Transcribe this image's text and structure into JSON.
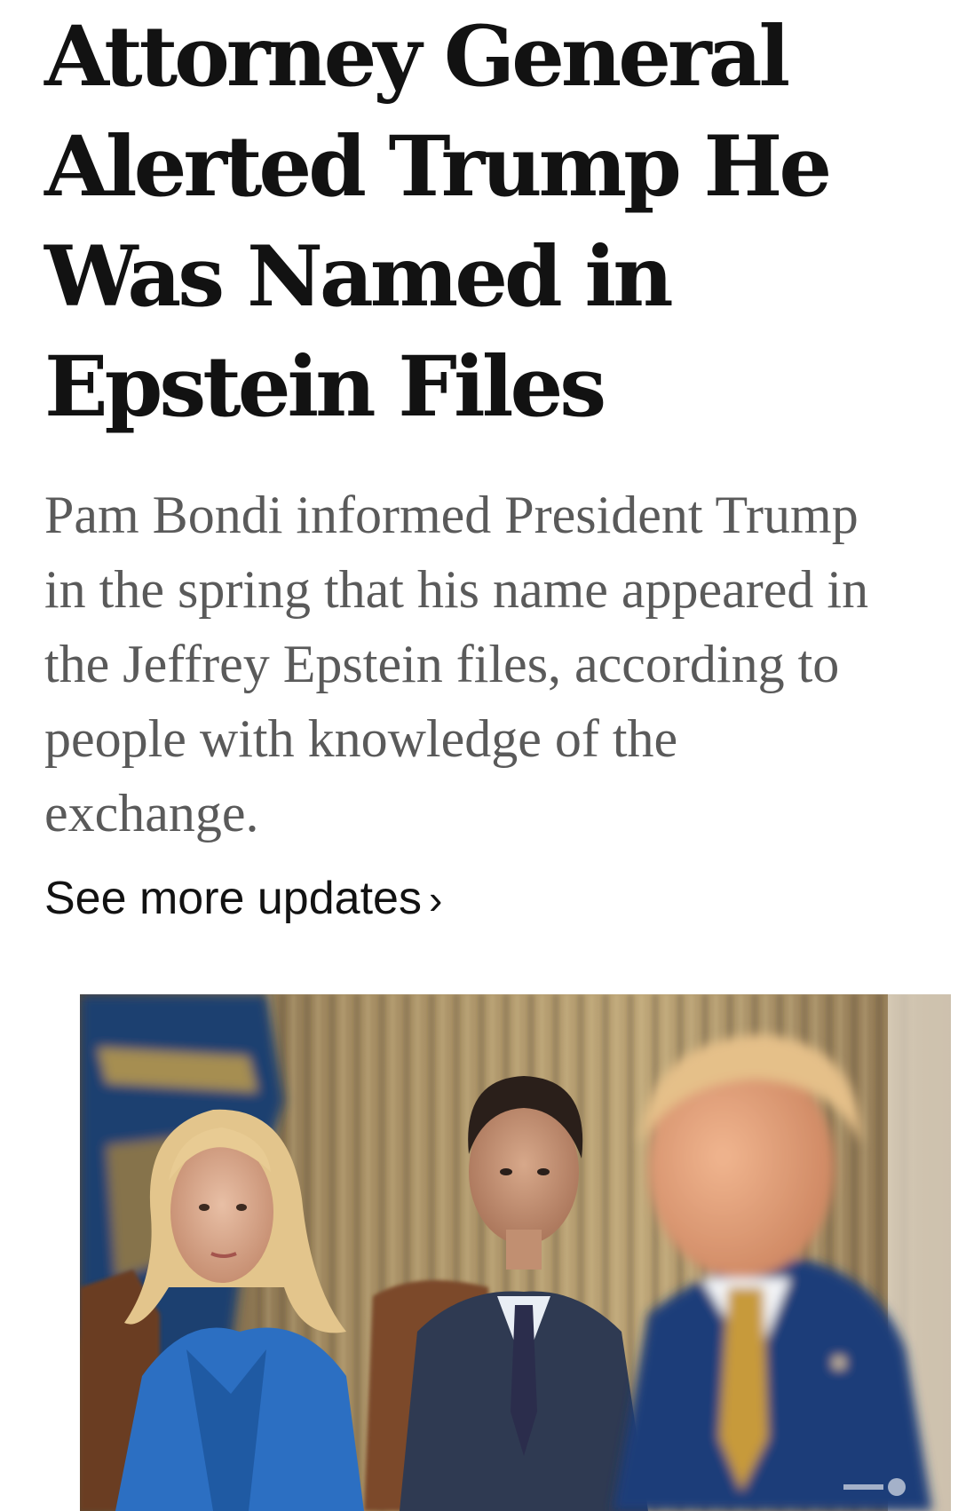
{
  "article": {
    "headline": "Attorney General Alerted Trump He Was Named in Epstein Files",
    "summary": "Pam Bondi informed President Trump in the spring that his name appeared in the Jeffrey Epstein files, according to people with knowledge of the exchange.",
    "more_link": "See more updates",
    "more_icon": "chevron-right-icon",
    "photo": {
      "description_icon": "news-photo"
    }
  }
}
